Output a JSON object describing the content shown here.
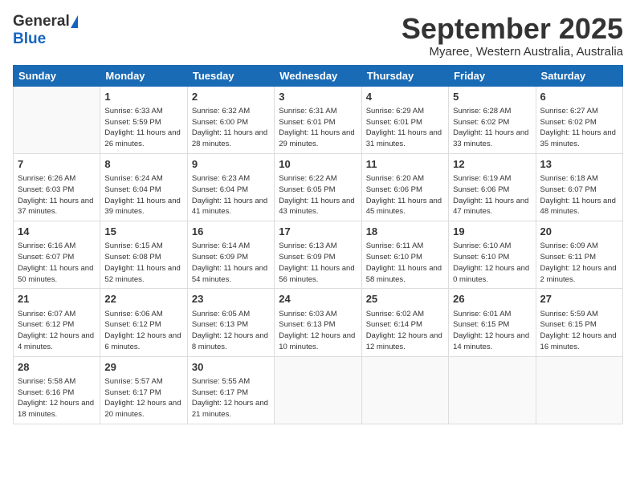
{
  "header": {
    "logo_general": "General",
    "logo_blue": "Blue",
    "month_title": "September 2025",
    "location": "Myaree, Western Australia, Australia"
  },
  "weekdays": [
    "Sunday",
    "Monday",
    "Tuesday",
    "Wednesday",
    "Thursday",
    "Friday",
    "Saturday"
  ],
  "weeks": [
    [
      {
        "day": "",
        "sunrise": "",
        "sunset": "",
        "daylight": ""
      },
      {
        "day": "1",
        "sunrise": "Sunrise: 6:33 AM",
        "sunset": "Sunset: 5:59 PM",
        "daylight": "Daylight: 11 hours and 26 minutes."
      },
      {
        "day": "2",
        "sunrise": "Sunrise: 6:32 AM",
        "sunset": "Sunset: 6:00 PM",
        "daylight": "Daylight: 11 hours and 28 minutes."
      },
      {
        "day": "3",
        "sunrise": "Sunrise: 6:31 AM",
        "sunset": "Sunset: 6:01 PM",
        "daylight": "Daylight: 11 hours and 29 minutes."
      },
      {
        "day": "4",
        "sunrise": "Sunrise: 6:29 AM",
        "sunset": "Sunset: 6:01 PM",
        "daylight": "Daylight: 11 hours and 31 minutes."
      },
      {
        "day": "5",
        "sunrise": "Sunrise: 6:28 AM",
        "sunset": "Sunset: 6:02 PM",
        "daylight": "Daylight: 11 hours and 33 minutes."
      },
      {
        "day": "6",
        "sunrise": "Sunrise: 6:27 AM",
        "sunset": "Sunset: 6:02 PM",
        "daylight": "Daylight: 11 hours and 35 minutes."
      }
    ],
    [
      {
        "day": "7",
        "sunrise": "Sunrise: 6:26 AM",
        "sunset": "Sunset: 6:03 PM",
        "daylight": "Daylight: 11 hours and 37 minutes."
      },
      {
        "day": "8",
        "sunrise": "Sunrise: 6:24 AM",
        "sunset": "Sunset: 6:04 PM",
        "daylight": "Daylight: 11 hours and 39 minutes."
      },
      {
        "day": "9",
        "sunrise": "Sunrise: 6:23 AM",
        "sunset": "Sunset: 6:04 PM",
        "daylight": "Daylight: 11 hours and 41 minutes."
      },
      {
        "day": "10",
        "sunrise": "Sunrise: 6:22 AM",
        "sunset": "Sunset: 6:05 PM",
        "daylight": "Daylight: 11 hours and 43 minutes."
      },
      {
        "day": "11",
        "sunrise": "Sunrise: 6:20 AM",
        "sunset": "Sunset: 6:06 PM",
        "daylight": "Daylight: 11 hours and 45 minutes."
      },
      {
        "day": "12",
        "sunrise": "Sunrise: 6:19 AM",
        "sunset": "Sunset: 6:06 PM",
        "daylight": "Daylight: 11 hours and 47 minutes."
      },
      {
        "day": "13",
        "sunrise": "Sunrise: 6:18 AM",
        "sunset": "Sunset: 6:07 PM",
        "daylight": "Daylight: 11 hours and 48 minutes."
      }
    ],
    [
      {
        "day": "14",
        "sunrise": "Sunrise: 6:16 AM",
        "sunset": "Sunset: 6:07 PM",
        "daylight": "Daylight: 11 hours and 50 minutes."
      },
      {
        "day": "15",
        "sunrise": "Sunrise: 6:15 AM",
        "sunset": "Sunset: 6:08 PM",
        "daylight": "Daylight: 11 hours and 52 minutes."
      },
      {
        "day": "16",
        "sunrise": "Sunrise: 6:14 AM",
        "sunset": "Sunset: 6:09 PM",
        "daylight": "Daylight: 11 hours and 54 minutes."
      },
      {
        "day": "17",
        "sunrise": "Sunrise: 6:13 AM",
        "sunset": "Sunset: 6:09 PM",
        "daylight": "Daylight: 11 hours and 56 minutes."
      },
      {
        "day": "18",
        "sunrise": "Sunrise: 6:11 AM",
        "sunset": "Sunset: 6:10 PM",
        "daylight": "Daylight: 11 hours and 58 minutes."
      },
      {
        "day": "19",
        "sunrise": "Sunrise: 6:10 AM",
        "sunset": "Sunset: 6:10 PM",
        "daylight": "Daylight: 12 hours and 0 minutes."
      },
      {
        "day": "20",
        "sunrise": "Sunrise: 6:09 AM",
        "sunset": "Sunset: 6:11 PM",
        "daylight": "Daylight: 12 hours and 2 minutes."
      }
    ],
    [
      {
        "day": "21",
        "sunrise": "Sunrise: 6:07 AM",
        "sunset": "Sunset: 6:12 PM",
        "daylight": "Daylight: 12 hours and 4 minutes."
      },
      {
        "day": "22",
        "sunrise": "Sunrise: 6:06 AM",
        "sunset": "Sunset: 6:12 PM",
        "daylight": "Daylight: 12 hours and 6 minutes."
      },
      {
        "day": "23",
        "sunrise": "Sunrise: 6:05 AM",
        "sunset": "Sunset: 6:13 PM",
        "daylight": "Daylight: 12 hours and 8 minutes."
      },
      {
        "day": "24",
        "sunrise": "Sunrise: 6:03 AM",
        "sunset": "Sunset: 6:13 PM",
        "daylight": "Daylight: 12 hours and 10 minutes."
      },
      {
        "day": "25",
        "sunrise": "Sunrise: 6:02 AM",
        "sunset": "Sunset: 6:14 PM",
        "daylight": "Daylight: 12 hours and 12 minutes."
      },
      {
        "day": "26",
        "sunrise": "Sunrise: 6:01 AM",
        "sunset": "Sunset: 6:15 PM",
        "daylight": "Daylight: 12 hours and 14 minutes."
      },
      {
        "day": "27",
        "sunrise": "Sunrise: 5:59 AM",
        "sunset": "Sunset: 6:15 PM",
        "daylight": "Daylight: 12 hours and 16 minutes."
      }
    ],
    [
      {
        "day": "28",
        "sunrise": "Sunrise: 5:58 AM",
        "sunset": "Sunset: 6:16 PM",
        "daylight": "Daylight: 12 hours and 18 minutes."
      },
      {
        "day": "29",
        "sunrise": "Sunrise: 5:57 AM",
        "sunset": "Sunset: 6:17 PM",
        "daylight": "Daylight: 12 hours and 20 minutes."
      },
      {
        "day": "30",
        "sunrise": "Sunrise: 5:55 AM",
        "sunset": "Sunset: 6:17 PM",
        "daylight": "Daylight: 12 hours and 21 minutes."
      },
      {
        "day": "",
        "sunrise": "",
        "sunset": "",
        "daylight": ""
      },
      {
        "day": "",
        "sunrise": "",
        "sunset": "",
        "daylight": ""
      },
      {
        "day": "",
        "sunrise": "",
        "sunset": "",
        "daylight": ""
      },
      {
        "day": "",
        "sunrise": "",
        "sunset": "",
        "daylight": ""
      }
    ]
  ]
}
